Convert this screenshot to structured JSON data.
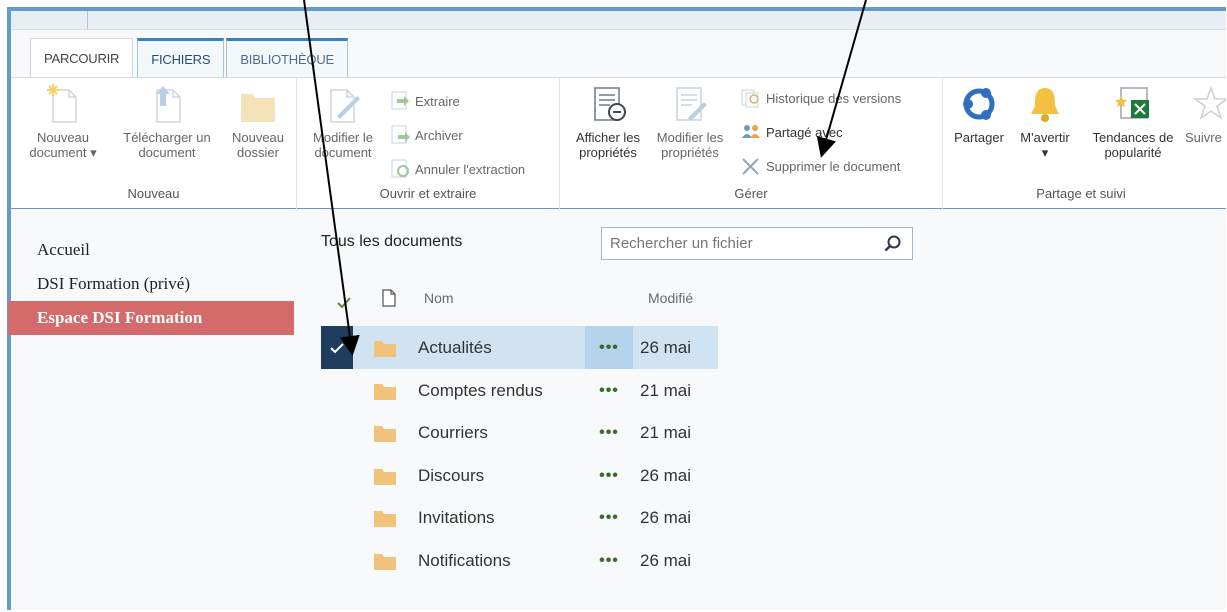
{
  "tabs": [
    "PARCOURIR",
    "FICHIERS",
    "BIBLIOTHÈQUE"
  ],
  "ribbon": {
    "nouveau": {
      "label": "Nouveau",
      "new_doc": "Nouveau\ndocument ▾",
      "upload": "Télécharger un\ndocument",
      "new_folder": "Nouveau\ndossier"
    },
    "ouvrir": {
      "label": "Ouvrir et extraire",
      "edit": "Modifier le\ndocument",
      "extract": "Extraire",
      "archive": "Archiver",
      "cancel": "Annuler l'extraction"
    },
    "gerer": {
      "label": "Gérer",
      "view_props": "Afficher les\npropriétés",
      "edit_props": "Modifier les\npropriétés",
      "history": "Historique des versions",
      "shared": "Partagé avec",
      "delete": "Supprimer le document"
    },
    "partage": {
      "label": "Partage et suivi",
      "share": "Partager",
      "alert": "M'avertir\n▾",
      "trends": "Tendances de\npopularité",
      "follow": "Suivre"
    }
  },
  "nav": {
    "items": [
      "Accueil",
      "DSI Formation (privé)",
      "Espace DSI Formation"
    ]
  },
  "view_title": "Tous les documents",
  "search": {
    "placeholder": "Rechercher un fichier"
  },
  "list": {
    "col_name": "Nom",
    "col_modified": "Modifié",
    "dots": "•••",
    "rows": [
      {
        "name": "Actualités",
        "modified": "26 mai"
      },
      {
        "name": "Comptes rendus",
        "modified": "21 mai"
      },
      {
        "name": "Courriers",
        "modified": "21 mai"
      },
      {
        "name": "Discours",
        "modified": "26 mai"
      },
      {
        "name": "Invitations",
        "modified": "26 mai"
      },
      {
        "name": "Notifications",
        "modified": "26 mai"
      }
    ]
  },
  "colors": {
    "accent": "#3a7fc2",
    "nav_active": "#d46a6a",
    "row_selected": "#cfe3f2",
    "check_bg": "#1f3d5e",
    "folder": "#f0c27a"
  }
}
